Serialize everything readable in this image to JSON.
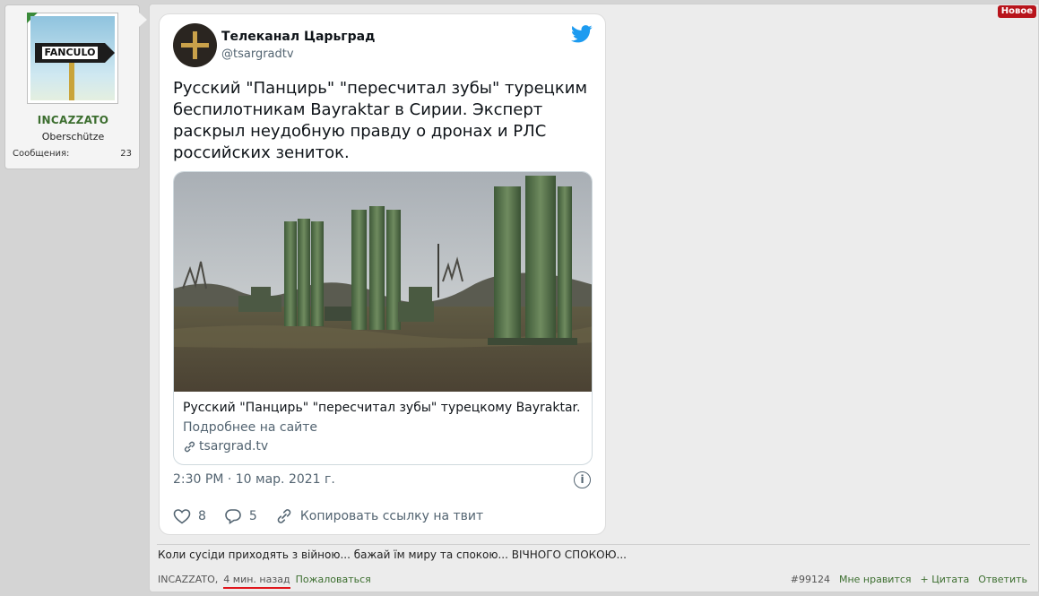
{
  "user": {
    "name": "INCAZZATO",
    "title": "Oberschütze",
    "avatar_sign_text": "FANCULO",
    "messages_label": "Сообщения:",
    "messages_count": "23"
  },
  "badge": {
    "new_label": "Новое"
  },
  "tweet": {
    "author_name": "Телеканал Царьград",
    "author_handle": "@tsargradtv",
    "text": "Русский \"Панцирь\" \"пересчитал зубы\" турецким беспилотникам Bayraktar в Сирии. Эксперт раскрыл неудобную правду о дронах и РЛС российских зениток.",
    "card": {
      "title": "Русский \"Панцирь\" \"пересчитал зубы\" турецкому Bayraktar. Эк...",
      "more_label": "Подробнее на сайте",
      "domain": "tsargrad.tv"
    },
    "timestamp": "2:30 PM · 10 мар. 2021 г.",
    "info_icon_text": "i",
    "likes": "8",
    "replies": "5",
    "copy_link_label": "Копировать ссылку на твит"
  },
  "post": {
    "signature": "Коли сусіди приходять з війною... бажай їм миру та спокою... ВІЧНОГО СПОКОЮ...",
    "author": "INCAZZATO,",
    "time_ago": "4 мин. назад",
    "report_label": "Пожаловаться",
    "post_number": "#99124",
    "like_label": "Мне нравится",
    "quote_label": "+ Цитата",
    "reply_label": "Ответить"
  },
  "colors": {
    "accent_green": "#3c6e2f",
    "badge_red": "#b8141b",
    "twitter_blue": "#1d9bf0",
    "underline_red": "#e0161d"
  }
}
